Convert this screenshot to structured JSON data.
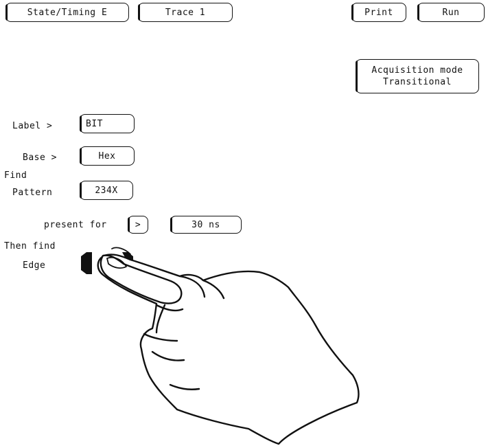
{
  "header": {
    "menu_label": "State/Timing E",
    "trace_label": "Trace 1",
    "print_label": "Print",
    "run_label": "Run"
  },
  "acquisition": {
    "title": "Acquisition mode",
    "value": "Transitional"
  },
  "trace_spec": {
    "label_caption": "Label >",
    "label_value": "BIT",
    "base_caption": "Base >",
    "base_value": "Hex",
    "find_caption": "Find",
    "pattern_caption": "Pattern",
    "pattern_value": "234X",
    "present_for_caption": "present for",
    "present_for_operator": ">",
    "present_for_duration": "30 ns",
    "then_find_caption": "Then find",
    "edge_caption": "Edge"
  },
  "illustration": {
    "icon": "pointing-hand-icon"
  }
}
